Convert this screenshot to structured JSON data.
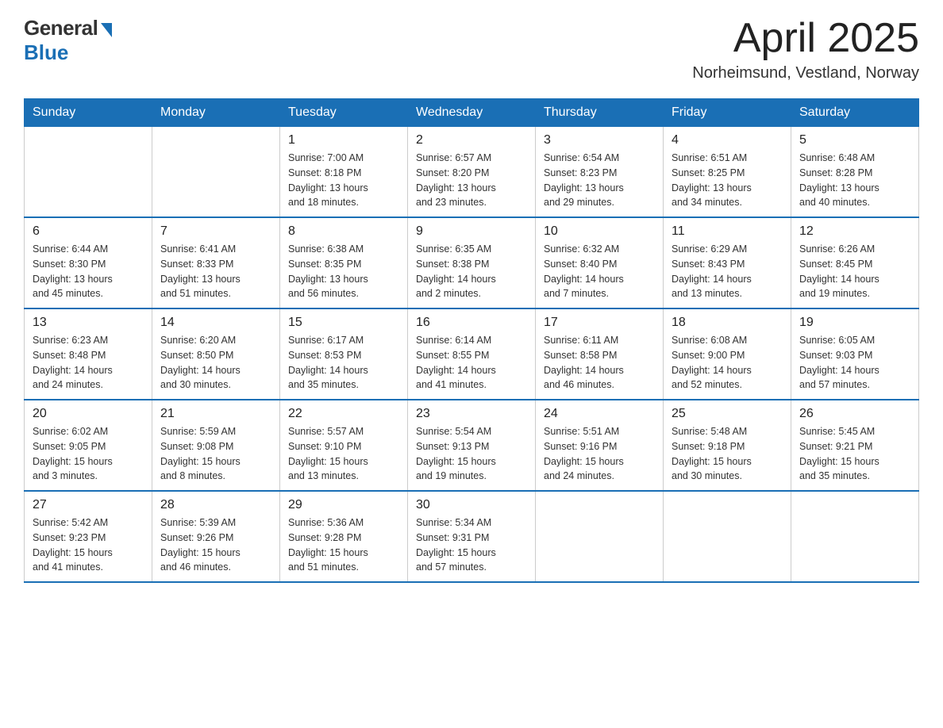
{
  "header": {
    "logo_general": "General",
    "logo_blue": "Blue",
    "month_title": "April 2025",
    "location": "Norheimsund, Vestland, Norway"
  },
  "days_of_week": [
    "Sunday",
    "Monday",
    "Tuesday",
    "Wednesday",
    "Thursday",
    "Friday",
    "Saturday"
  ],
  "weeks": [
    [
      {
        "day": "",
        "info": ""
      },
      {
        "day": "",
        "info": ""
      },
      {
        "day": "1",
        "info": "Sunrise: 7:00 AM\nSunset: 8:18 PM\nDaylight: 13 hours\nand 18 minutes."
      },
      {
        "day": "2",
        "info": "Sunrise: 6:57 AM\nSunset: 8:20 PM\nDaylight: 13 hours\nand 23 minutes."
      },
      {
        "day": "3",
        "info": "Sunrise: 6:54 AM\nSunset: 8:23 PM\nDaylight: 13 hours\nand 29 minutes."
      },
      {
        "day": "4",
        "info": "Sunrise: 6:51 AM\nSunset: 8:25 PM\nDaylight: 13 hours\nand 34 minutes."
      },
      {
        "day": "5",
        "info": "Sunrise: 6:48 AM\nSunset: 8:28 PM\nDaylight: 13 hours\nand 40 minutes."
      }
    ],
    [
      {
        "day": "6",
        "info": "Sunrise: 6:44 AM\nSunset: 8:30 PM\nDaylight: 13 hours\nand 45 minutes."
      },
      {
        "day": "7",
        "info": "Sunrise: 6:41 AM\nSunset: 8:33 PM\nDaylight: 13 hours\nand 51 minutes."
      },
      {
        "day": "8",
        "info": "Sunrise: 6:38 AM\nSunset: 8:35 PM\nDaylight: 13 hours\nand 56 minutes."
      },
      {
        "day": "9",
        "info": "Sunrise: 6:35 AM\nSunset: 8:38 PM\nDaylight: 14 hours\nand 2 minutes."
      },
      {
        "day": "10",
        "info": "Sunrise: 6:32 AM\nSunset: 8:40 PM\nDaylight: 14 hours\nand 7 minutes."
      },
      {
        "day": "11",
        "info": "Sunrise: 6:29 AM\nSunset: 8:43 PM\nDaylight: 14 hours\nand 13 minutes."
      },
      {
        "day": "12",
        "info": "Sunrise: 6:26 AM\nSunset: 8:45 PM\nDaylight: 14 hours\nand 19 minutes."
      }
    ],
    [
      {
        "day": "13",
        "info": "Sunrise: 6:23 AM\nSunset: 8:48 PM\nDaylight: 14 hours\nand 24 minutes."
      },
      {
        "day": "14",
        "info": "Sunrise: 6:20 AM\nSunset: 8:50 PM\nDaylight: 14 hours\nand 30 minutes."
      },
      {
        "day": "15",
        "info": "Sunrise: 6:17 AM\nSunset: 8:53 PM\nDaylight: 14 hours\nand 35 minutes."
      },
      {
        "day": "16",
        "info": "Sunrise: 6:14 AM\nSunset: 8:55 PM\nDaylight: 14 hours\nand 41 minutes."
      },
      {
        "day": "17",
        "info": "Sunrise: 6:11 AM\nSunset: 8:58 PM\nDaylight: 14 hours\nand 46 minutes."
      },
      {
        "day": "18",
        "info": "Sunrise: 6:08 AM\nSunset: 9:00 PM\nDaylight: 14 hours\nand 52 minutes."
      },
      {
        "day": "19",
        "info": "Sunrise: 6:05 AM\nSunset: 9:03 PM\nDaylight: 14 hours\nand 57 minutes."
      }
    ],
    [
      {
        "day": "20",
        "info": "Sunrise: 6:02 AM\nSunset: 9:05 PM\nDaylight: 15 hours\nand 3 minutes."
      },
      {
        "day": "21",
        "info": "Sunrise: 5:59 AM\nSunset: 9:08 PM\nDaylight: 15 hours\nand 8 minutes."
      },
      {
        "day": "22",
        "info": "Sunrise: 5:57 AM\nSunset: 9:10 PM\nDaylight: 15 hours\nand 13 minutes."
      },
      {
        "day": "23",
        "info": "Sunrise: 5:54 AM\nSunset: 9:13 PM\nDaylight: 15 hours\nand 19 minutes."
      },
      {
        "day": "24",
        "info": "Sunrise: 5:51 AM\nSunset: 9:16 PM\nDaylight: 15 hours\nand 24 minutes."
      },
      {
        "day": "25",
        "info": "Sunrise: 5:48 AM\nSunset: 9:18 PM\nDaylight: 15 hours\nand 30 minutes."
      },
      {
        "day": "26",
        "info": "Sunrise: 5:45 AM\nSunset: 9:21 PM\nDaylight: 15 hours\nand 35 minutes."
      }
    ],
    [
      {
        "day": "27",
        "info": "Sunrise: 5:42 AM\nSunset: 9:23 PM\nDaylight: 15 hours\nand 41 minutes."
      },
      {
        "day": "28",
        "info": "Sunrise: 5:39 AM\nSunset: 9:26 PM\nDaylight: 15 hours\nand 46 minutes."
      },
      {
        "day": "29",
        "info": "Sunrise: 5:36 AM\nSunset: 9:28 PM\nDaylight: 15 hours\nand 51 minutes."
      },
      {
        "day": "30",
        "info": "Sunrise: 5:34 AM\nSunset: 9:31 PM\nDaylight: 15 hours\nand 57 minutes."
      },
      {
        "day": "",
        "info": ""
      },
      {
        "day": "",
        "info": ""
      },
      {
        "day": "",
        "info": ""
      }
    ]
  ]
}
